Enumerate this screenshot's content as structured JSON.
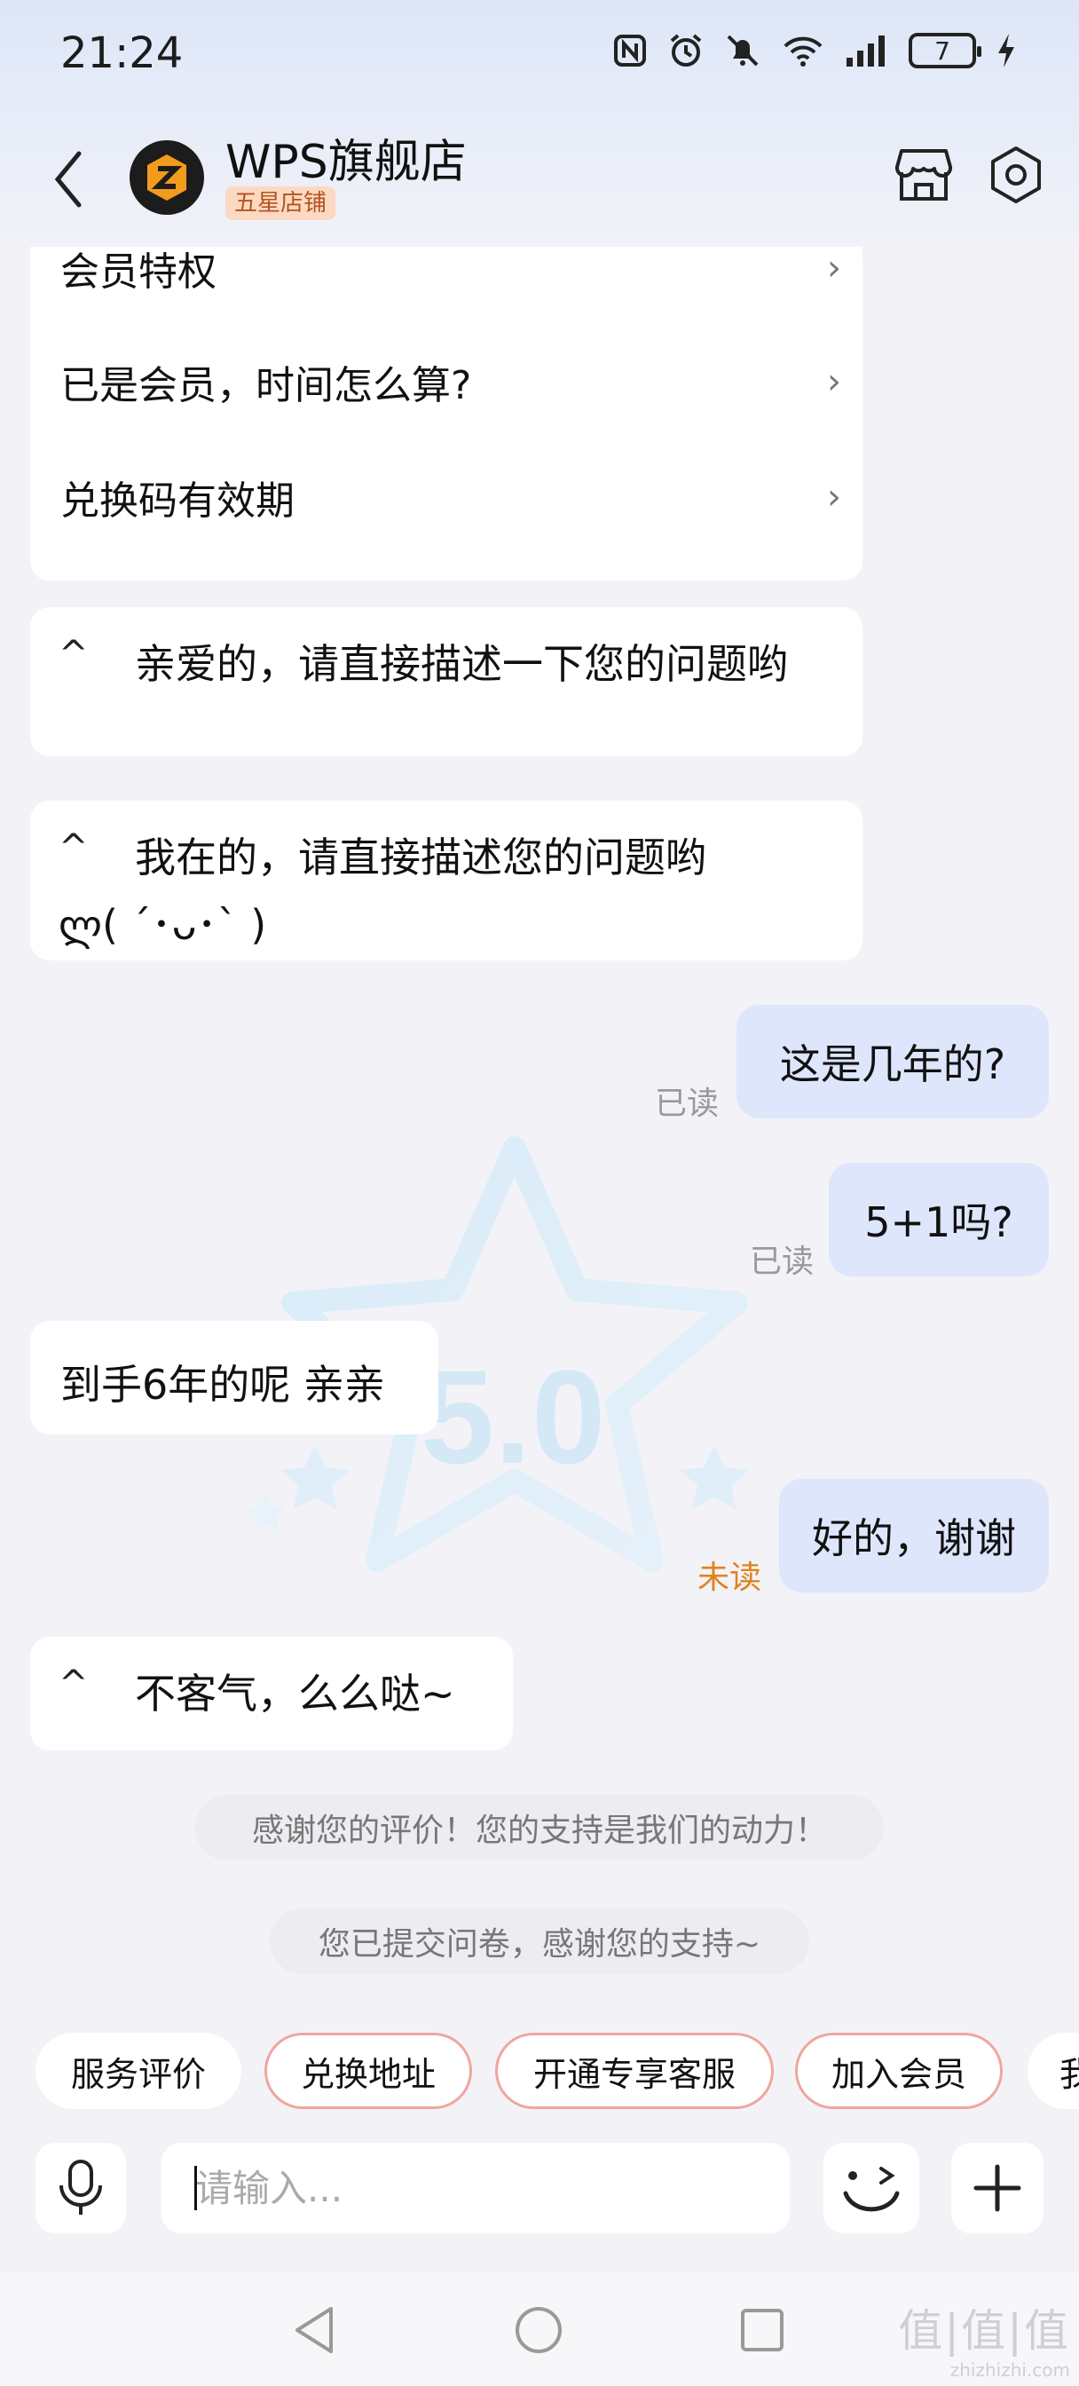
{
  "status_bar": {
    "time": "21:24",
    "battery_level": "7",
    "icons": [
      "nfc-icon",
      "alarm-icon",
      "mute-icon",
      "wifi-icon",
      "signal-icon",
      "battery-icon",
      "charging-icon"
    ]
  },
  "header": {
    "store_name": "WPS旗舰店",
    "store_badge": "五星店铺",
    "icons": [
      "back-icon",
      "store-logo",
      "shop-icon",
      "settings-icon"
    ]
  },
  "faq": {
    "items": [
      {
        "label": "会员特权",
        "chevron": "›"
      },
      {
        "label": "已是会员，时间怎么算?",
        "chevron": "›"
      },
      {
        "label": "兑换码有效期",
        "chevron": "›"
      }
    ]
  },
  "messages": {
    "caret": "^",
    "bot1": "亲爱的，请直接描述一下您的问题哟",
    "bot2_line1": "我在的，请直接描述您的问题哟",
    "bot2_line2": "ლ( ´･ᴗ･` )",
    "user1": "这是几年的?",
    "user1_status": "已读",
    "user2": "5+1吗?",
    "user2_status": "已读",
    "agent_reply": "到手6年的呢  亲亲",
    "user3": "好的，谢谢",
    "user3_status": "未读",
    "bot3": "不客气，么么哒~"
  },
  "watermark": {
    "rating": "5.0"
  },
  "system_notes": {
    "rating_thanks": "感谢您的评价！您的支持是我们的动力！",
    "survey_thanks": "您已提交问卷，感谢您的支持~"
  },
  "quick_replies": [
    {
      "label": "服务评价"
    },
    {
      "label": "兑换地址"
    },
    {
      "label": "开通专享客服"
    },
    {
      "label": "加入会员"
    },
    {
      "label": "我"
    }
  ],
  "input_bar": {
    "placeholder": "请输入...",
    "value": ""
  },
  "colors": {
    "user_bubble": "#dde6fb",
    "unread": "#e0821f",
    "chip_border": "#f0a5a0",
    "badge_bg": "#fbd9c2",
    "badge_text": "#b3541e"
  },
  "site_mark": {
    "big": "值|值|值",
    "small": "zhizhizhi.com"
  }
}
